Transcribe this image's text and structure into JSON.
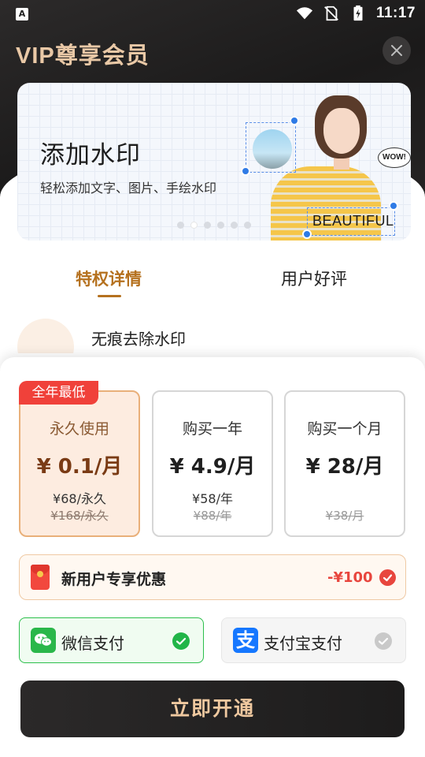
{
  "status_bar": {
    "left_icon": "A",
    "time": "11:17",
    "icons": [
      "wifi-icon",
      "no-sim-icon",
      "battery-charging-icon"
    ]
  },
  "header": {
    "title": "VIP尊享会员",
    "close_icon": "close-icon"
  },
  "banner": {
    "title": "添加水印",
    "subtitle": "轻松添加文字、图片、手绘水印",
    "sticker_text": "WOW!",
    "watermark_text": "BEAUTIFUL",
    "dots": 6,
    "active_dot": 1
  },
  "tabs": [
    {
      "label": "特权详情",
      "active": true
    },
    {
      "label": "用户好评",
      "active": false
    }
  ],
  "features": [
    {
      "label": "无痕去除水印"
    }
  ],
  "plans": [
    {
      "badge": "全年最低",
      "name": "永久使用",
      "price": "¥ 0.1/月",
      "sub": "¥68/永久",
      "original": "¥168/永久",
      "selected": true
    },
    {
      "name": "购买一年",
      "price": "¥ 4.9/月",
      "sub": "¥58/年",
      "original": "¥88/年",
      "selected": false
    },
    {
      "name": "购买一个月",
      "price": "¥ 28/月",
      "sub": "",
      "original": "¥38/月",
      "selected": false
    }
  ],
  "coupon": {
    "label": "新用户专享优惠",
    "amount": "-¥100",
    "checked": true
  },
  "payment": [
    {
      "label": "微信支付",
      "selected": true,
      "icon": "wechat-icon"
    },
    {
      "label": "支付宝支付",
      "selected": false,
      "icon": "alipay-icon",
      "logo_text": "支"
    }
  ],
  "cta": {
    "label": "立即开通"
  },
  "colors": {
    "gold": "#e9c8a6",
    "accent_brown": "#b5711f",
    "badge_red": "#f0413a",
    "wechat_green": "#2ab74a",
    "alipay_blue": "#1677ff"
  }
}
